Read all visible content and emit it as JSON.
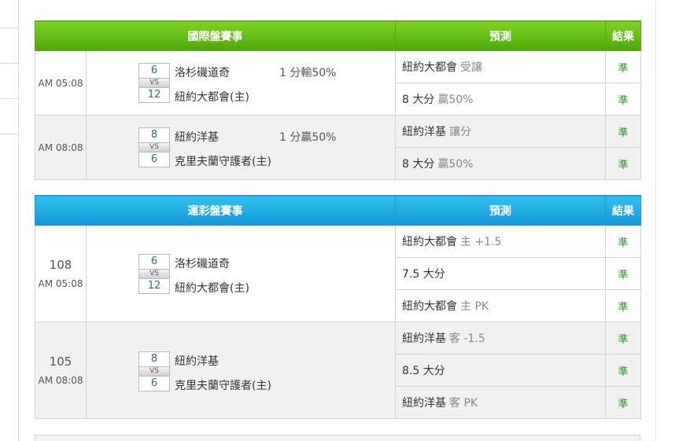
{
  "international": {
    "header": {
      "match": "國際盤賽事",
      "pred": "預測",
      "result": "結果"
    },
    "games": [
      {
        "time": "AM 05:08",
        "away_score": "6",
        "home_score": "12",
        "vs": "VS",
        "away_team": "洛杉磯道奇",
        "home_team": "紐約大都會(主)",
        "handicap": "1 分輸50%",
        "predictions": [
          {
            "main": "紐約大都會",
            "sub": "受讓",
            "result": "準"
          },
          {
            "main": "8 大分",
            "sub": "贏50%",
            "result": "準"
          }
        ]
      },
      {
        "time": "AM 08:08",
        "away_score": "8",
        "home_score": "6",
        "vs": "VS",
        "away_team": "紐約洋基",
        "home_team": "克里夫蘭守護者(主)",
        "handicap": "1 分贏50%",
        "predictions": [
          {
            "main": "紐約洋基",
            "sub": "讓分",
            "result": "準"
          },
          {
            "main": "8 大分",
            "sub": "贏50%",
            "result": "準"
          }
        ]
      }
    ]
  },
  "lottery": {
    "header": {
      "match": "運彩盤賽事",
      "pred": "預測",
      "result": "結果"
    },
    "games": [
      {
        "num": "108",
        "time": "AM 05:08",
        "away_score": "6",
        "home_score": "12",
        "vs": "VS",
        "away_team": "洛杉磯道奇",
        "home_team": "紐約大都會(主)",
        "predictions": [
          {
            "main": "紐約大都會",
            "sub": "主 +1.5",
            "result": "準"
          },
          {
            "main": "7.5 大分",
            "sub": "",
            "result": "準"
          },
          {
            "main": "紐約大都會",
            "sub": "主 PK",
            "result": "準"
          }
        ]
      },
      {
        "num": "105",
        "time": "AM 08:08",
        "away_score": "8",
        "home_score": "6",
        "vs": "VS",
        "away_team": "紐約洋基",
        "home_team": "克里夫蘭守護者(主)",
        "predictions": [
          {
            "main": "紐約洋基",
            "sub": "客 -1.5",
            "result": "準"
          },
          {
            "main": "8.5 大分",
            "sub": "",
            "result": "準"
          },
          {
            "main": "紐約洋基",
            "sub": "客 PK",
            "result": "準"
          }
        ]
      }
    ]
  }
}
